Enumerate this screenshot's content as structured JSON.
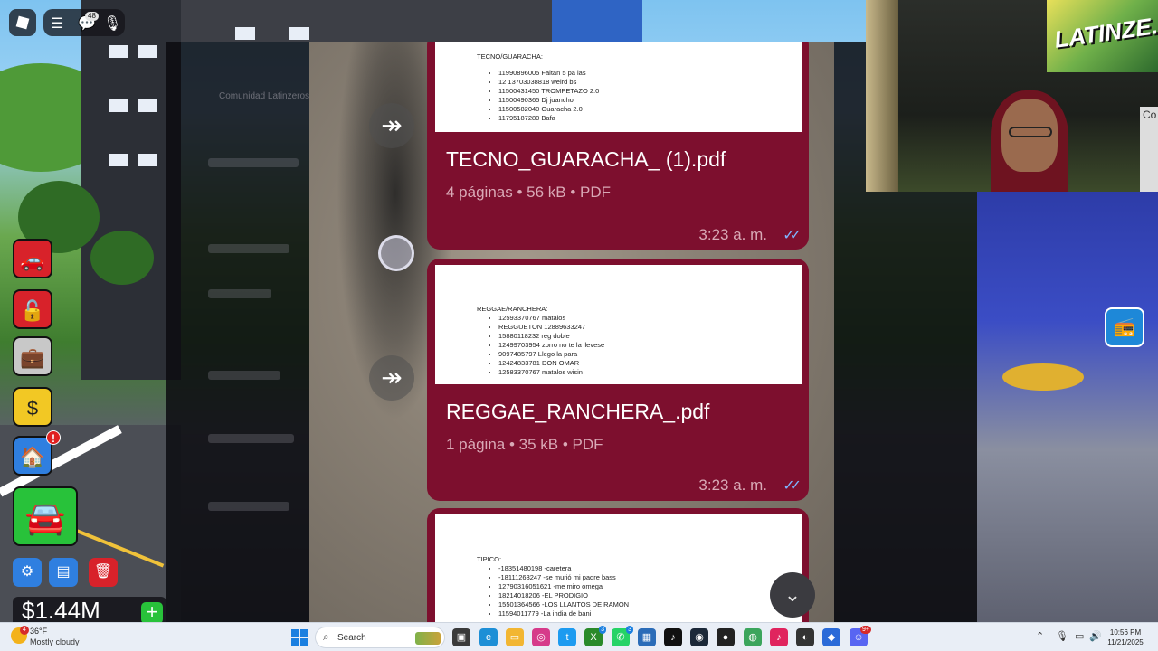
{
  "roblox": {
    "notification_count": "48",
    "balance": "$1.44M",
    "add_funds_label": "+",
    "alert_mark": "!"
  },
  "discord": {
    "server_title": "Comunidad Latinzeros"
  },
  "chat": {
    "messages": [
      {
        "preview_heading": "TECNO/GUARACHA:",
        "preview_lines": [
          "11990896005 Faltan 5 pa las",
          "12 13703038818 weird bs",
          "11500431450 TROMPETAZO 2.0",
          "11500490365 Dj juancho",
          "11500582040 Guaracha 2.0",
          "11795187280 Bafa"
        ],
        "file_name": "TECNO_GUARACHA_ (1).pdf",
        "file_meta": "4 páginas • 56 kB • PDF",
        "time": "3:23 a. m."
      },
      {
        "preview_heading": "REGGAE/RANCHERA:",
        "preview_lines": [
          "12593370767 matalos",
          "REGGUETON 12889633247",
          "15880118232 reg doble",
          "12499703954 zorro no te la llevese",
          "9097485797 Llego la para",
          "12424833781 DON OMAR",
          "12583370767 matalos wisin"
        ],
        "file_name": "REGGAE_RANCHERA_.pdf",
        "file_meta": "1 página • 35 kB • PDF",
        "time": "3:23 a. m."
      },
      {
        "preview_heading": "TIPICO:",
        "preview_lines": [
          "-18351480198 -caretera",
          "-18111263247 -se murió mi padre bass",
          "12790316051621 -me miro omega",
          "18214018206 -EL PRODIGIO",
          "15501364566 -LOS LLANTOS DE RAMON",
          "11594011779 -La india de bani"
        ]
      }
    ],
    "forward_icon": "↠",
    "read_ticks": "✓✓",
    "scroll_down_icon": "⌄"
  },
  "webcam": {
    "wall_text": "LATINZE...",
    "side_label": "Co"
  },
  "taskbar": {
    "weather_badge": "4",
    "weather_temp": "36°F",
    "weather_desc": "Mostly cloudy",
    "search_placeholder": "Search",
    "app_badges": {
      "whatsapp": "3",
      "xbox": "3",
      "discord": "9+"
    },
    "time": "10:56 PM",
    "date": "11/21/2025"
  },
  "colors": {
    "bubble": "#7d0f2e",
    "meta_text": "#d9a9b6",
    "read_ticks": "#7fb6ff",
    "taskbar": "#e9eef6"
  }
}
